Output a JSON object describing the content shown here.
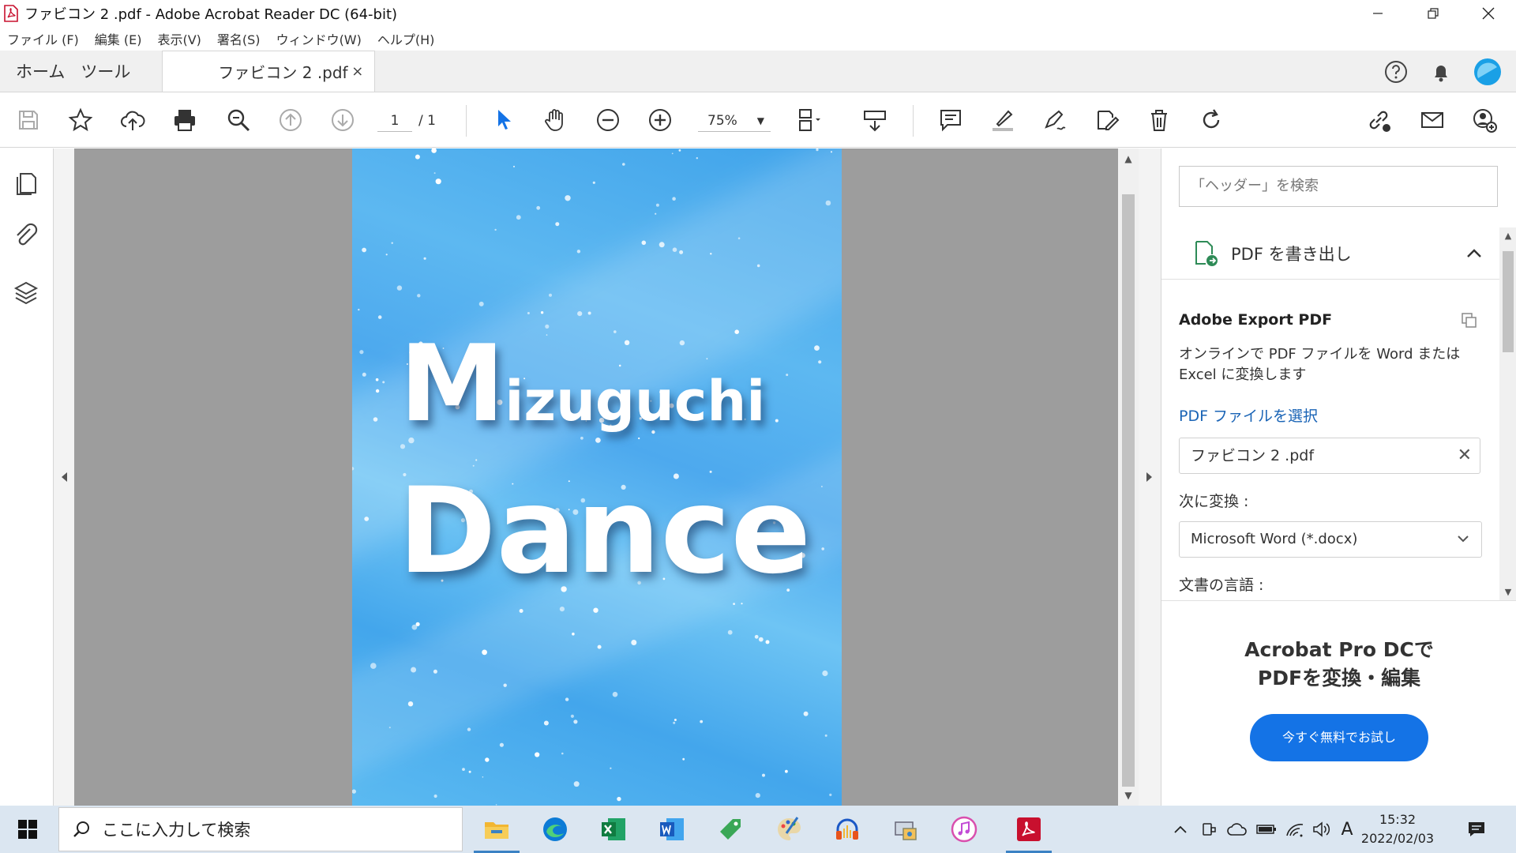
{
  "window": {
    "title": "ファビコン 2 .pdf - Adobe Acrobat Reader DC (64-bit)"
  },
  "menu": [
    "ファイル (F)",
    "編集 (E)",
    "表示(V)",
    "署名(S)",
    "ウィンドウ(W)",
    "ヘルプ(H)"
  ],
  "tabs": {
    "home": "ホーム",
    "tools": "ツール",
    "document": "ファビコン 2 .pdf",
    "close": "×"
  },
  "toolbar": {
    "page_current": "1",
    "page_total": "/ 1",
    "zoom": "75%"
  },
  "document_page": {
    "title_initial": "M",
    "title_rest": "izuguchi",
    "subtitle": "Dance"
  },
  "right_panel": {
    "search_placeholder": "「ヘッダー」を検索",
    "section_title": "PDF を書き出し",
    "export_title": "Adobe Export PDF",
    "export_description": "オンラインで PDF ファイルを Word または Excel に変換します",
    "select_file_link": "PDF ファイルを選択",
    "selected_file": "ファビコン 2 .pdf",
    "convert_to_label": "次に変換 :",
    "convert_format": "Microsoft Word (*.docx)",
    "document_language_label": "文書の言語 :",
    "promo_line1": "Acrobat Pro DCで",
    "promo_line2": "PDFを変換・編集",
    "promo_button": "今すぐ無料でお試し"
  },
  "taskbar": {
    "search_placeholder": "ここに入力して検索",
    "time": "15:32",
    "date": "2022/02/03",
    "ime": "A"
  },
  "colors": {
    "accent_blue": "#1473e6",
    "link_blue": "#1a64b6",
    "acrobat_red": "#c8102e",
    "viewer_gray": "#9d9d9d"
  }
}
